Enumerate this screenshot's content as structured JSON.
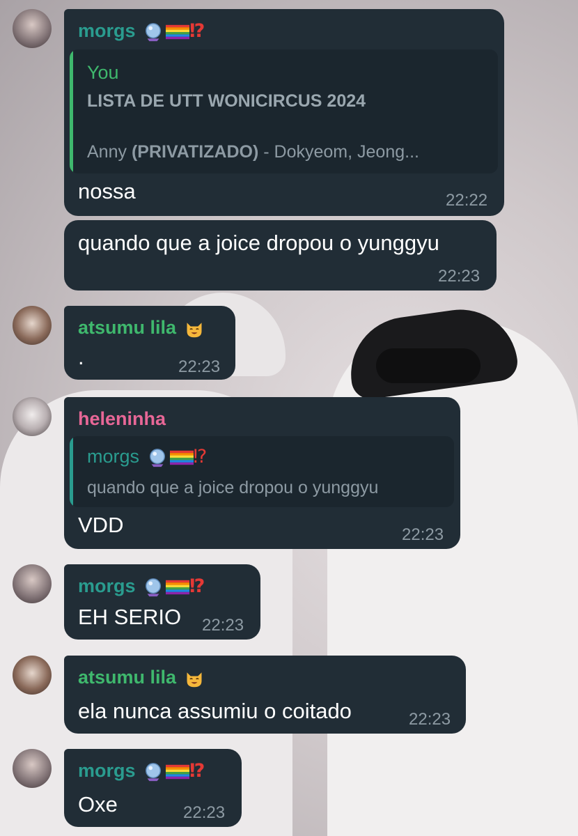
{
  "colors": {
    "bubble": "#212d36",
    "morgs": "#2a9c8f",
    "atsumu": "#3fb86d",
    "heleninha": "#e86797",
    "you": "#3fb86d",
    "timestamp": "#8d9aa3"
  },
  "messages": [
    {
      "sender": "morgs",
      "reply": {
        "author": "You",
        "title": "LISTA DE UTT WONICIRCUS 2024",
        "preview_name": "Anny",
        "preview_bold": "(PRIVATIZADO)",
        "preview_rest": " - Dokyeom, Jeong..."
      },
      "text": "nossa",
      "time": "22:22"
    },
    {
      "text": "quando que a joice dropou o yunggyu",
      "time": "22:23"
    },
    {
      "sender": "atsumu lila",
      "text": ".",
      "time": "22:23"
    },
    {
      "sender": "heleninha",
      "reply": {
        "author": "morgs",
        "text": "quando que a joice dropou o yunggyu"
      },
      "text": "VDD",
      "time": "22:23"
    },
    {
      "sender": "morgs",
      "text": "EH SERIO",
      "time": "22:23"
    },
    {
      "sender": "atsumu lila",
      "text": "ela nunca assumiu o coitado",
      "time": "22:23"
    },
    {
      "sender": "morgs",
      "text": "Oxe",
      "time": "22:23"
    }
  ],
  "emoji_icons": {
    "morgs": [
      "crystal-ball-icon",
      "rainbow-flag-icon",
      "exclamation-question-icon"
    ],
    "atsumu": [
      "smiling-cat-icon"
    ]
  },
  "punct": {
    "exq": "⁉"
  }
}
